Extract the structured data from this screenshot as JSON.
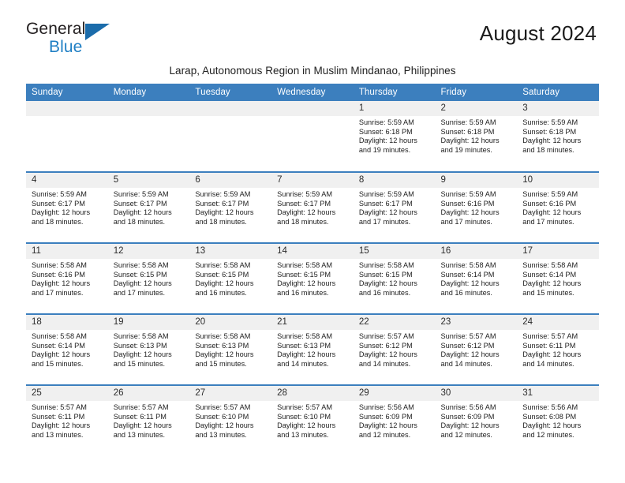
{
  "brand": {
    "logo_primary": "General",
    "logo_secondary": "Blue",
    "logo_icon": "triangle-mark",
    "accent_color": "#1b6cab",
    "secondary_color": "#1f7fc4"
  },
  "header": {
    "title": "August 2024",
    "subtitle": "Larap, Autonomous Region in Muslim Mindanao, Philippines",
    "header_bg_color": "#3c7fbe",
    "daynum_bg_color": "#f0f0f0"
  },
  "weekday_headers": [
    "Sunday",
    "Monday",
    "Tuesday",
    "Wednesday",
    "Thursday",
    "Friday",
    "Saturday"
  ],
  "labels": {
    "sunrise_prefix": "Sunrise:",
    "sunset_prefix": "Sunset:",
    "daylight_prefix": "Daylight:"
  },
  "weeks": [
    [
      {
        "day": "",
        "blank": true
      },
      {
        "day": "",
        "blank": true
      },
      {
        "day": "",
        "blank": true
      },
      {
        "day": "",
        "blank": true
      },
      {
        "day": "1",
        "sunrise": "Sunrise: 5:59 AM",
        "sunset": "Sunset: 6:18 PM",
        "daylight": "Daylight: 12 hours and 19 minutes."
      },
      {
        "day": "2",
        "sunrise": "Sunrise: 5:59 AM",
        "sunset": "Sunset: 6:18 PM",
        "daylight": "Daylight: 12 hours and 19 minutes."
      },
      {
        "day": "3",
        "sunrise": "Sunrise: 5:59 AM",
        "sunset": "Sunset: 6:18 PM",
        "daylight": "Daylight: 12 hours and 18 minutes."
      }
    ],
    [
      {
        "day": "4",
        "sunrise": "Sunrise: 5:59 AM",
        "sunset": "Sunset: 6:17 PM",
        "daylight": "Daylight: 12 hours and 18 minutes."
      },
      {
        "day": "5",
        "sunrise": "Sunrise: 5:59 AM",
        "sunset": "Sunset: 6:17 PM",
        "daylight": "Daylight: 12 hours and 18 minutes."
      },
      {
        "day": "6",
        "sunrise": "Sunrise: 5:59 AM",
        "sunset": "Sunset: 6:17 PM",
        "daylight": "Daylight: 12 hours and 18 minutes."
      },
      {
        "day": "7",
        "sunrise": "Sunrise: 5:59 AM",
        "sunset": "Sunset: 6:17 PM",
        "daylight": "Daylight: 12 hours and 18 minutes."
      },
      {
        "day": "8",
        "sunrise": "Sunrise: 5:59 AM",
        "sunset": "Sunset: 6:17 PM",
        "daylight": "Daylight: 12 hours and 17 minutes."
      },
      {
        "day": "9",
        "sunrise": "Sunrise: 5:59 AM",
        "sunset": "Sunset: 6:16 PM",
        "daylight": "Daylight: 12 hours and 17 minutes."
      },
      {
        "day": "10",
        "sunrise": "Sunrise: 5:59 AM",
        "sunset": "Sunset: 6:16 PM",
        "daylight": "Daylight: 12 hours and 17 minutes."
      }
    ],
    [
      {
        "day": "11",
        "sunrise": "Sunrise: 5:58 AM",
        "sunset": "Sunset: 6:16 PM",
        "daylight": "Daylight: 12 hours and 17 minutes."
      },
      {
        "day": "12",
        "sunrise": "Sunrise: 5:58 AM",
        "sunset": "Sunset: 6:15 PM",
        "daylight": "Daylight: 12 hours and 17 minutes."
      },
      {
        "day": "13",
        "sunrise": "Sunrise: 5:58 AM",
        "sunset": "Sunset: 6:15 PM",
        "daylight": "Daylight: 12 hours and 16 minutes."
      },
      {
        "day": "14",
        "sunrise": "Sunrise: 5:58 AM",
        "sunset": "Sunset: 6:15 PM",
        "daylight": "Daylight: 12 hours and 16 minutes."
      },
      {
        "day": "15",
        "sunrise": "Sunrise: 5:58 AM",
        "sunset": "Sunset: 6:15 PM",
        "daylight": "Daylight: 12 hours and 16 minutes."
      },
      {
        "day": "16",
        "sunrise": "Sunrise: 5:58 AM",
        "sunset": "Sunset: 6:14 PM",
        "daylight": "Daylight: 12 hours and 16 minutes."
      },
      {
        "day": "17",
        "sunrise": "Sunrise: 5:58 AM",
        "sunset": "Sunset: 6:14 PM",
        "daylight": "Daylight: 12 hours and 15 minutes."
      }
    ],
    [
      {
        "day": "18",
        "sunrise": "Sunrise: 5:58 AM",
        "sunset": "Sunset: 6:14 PM",
        "daylight": "Daylight: 12 hours and 15 minutes."
      },
      {
        "day": "19",
        "sunrise": "Sunrise: 5:58 AM",
        "sunset": "Sunset: 6:13 PM",
        "daylight": "Daylight: 12 hours and 15 minutes."
      },
      {
        "day": "20",
        "sunrise": "Sunrise: 5:58 AM",
        "sunset": "Sunset: 6:13 PM",
        "daylight": "Daylight: 12 hours and 15 minutes."
      },
      {
        "day": "21",
        "sunrise": "Sunrise: 5:58 AM",
        "sunset": "Sunset: 6:13 PM",
        "daylight": "Daylight: 12 hours and 14 minutes."
      },
      {
        "day": "22",
        "sunrise": "Sunrise: 5:57 AM",
        "sunset": "Sunset: 6:12 PM",
        "daylight": "Daylight: 12 hours and 14 minutes."
      },
      {
        "day": "23",
        "sunrise": "Sunrise: 5:57 AM",
        "sunset": "Sunset: 6:12 PM",
        "daylight": "Daylight: 12 hours and 14 minutes."
      },
      {
        "day": "24",
        "sunrise": "Sunrise: 5:57 AM",
        "sunset": "Sunset: 6:11 PM",
        "daylight": "Daylight: 12 hours and 14 minutes."
      }
    ],
    [
      {
        "day": "25",
        "sunrise": "Sunrise: 5:57 AM",
        "sunset": "Sunset: 6:11 PM",
        "daylight": "Daylight: 12 hours and 13 minutes."
      },
      {
        "day": "26",
        "sunrise": "Sunrise: 5:57 AM",
        "sunset": "Sunset: 6:11 PM",
        "daylight": "Daylight: 12 hours and 13 minutes."
      },
      {
        "day": "27",
        "sunrise": "Sunrise: 5:57 AM",
        "sunset": "Sunset: 6:10 PM",
        "daylight": "Daylight: 12 hours and 13 minutes."
      },
      {
        "day": "28",
        "sunrise": "Sunrise: 5:57 AM",
        "sunset": "Sunset: 6:10 PM",
        "daylight": "Daylight: 12 hours and 13 minutes."
      },
      {
        "day": "29",
        "sunrise": "Sunrise: 5:56 AM",
        "sunset": "Sunset: 6:09 PM",
        "daylight": "Daylight: 12 hours and 12 minutes."
      },
      {
        "day": "30",
        "sunrise": "Sunrise: 5:56 AM",
        "sunset": "Sunset: 6:09 PM",
        "daylight": "Daylight: 12 hours and 12 minutes."
      },
      {
        "day": "31",
        "sunrise": "Sunrise: 5:56 AM",
        "sunset": "Sunset: 6:08 PM",
        "daylight": "Daylight: 12 hours and 12 minutes."
      }
    ]
  ]
}
